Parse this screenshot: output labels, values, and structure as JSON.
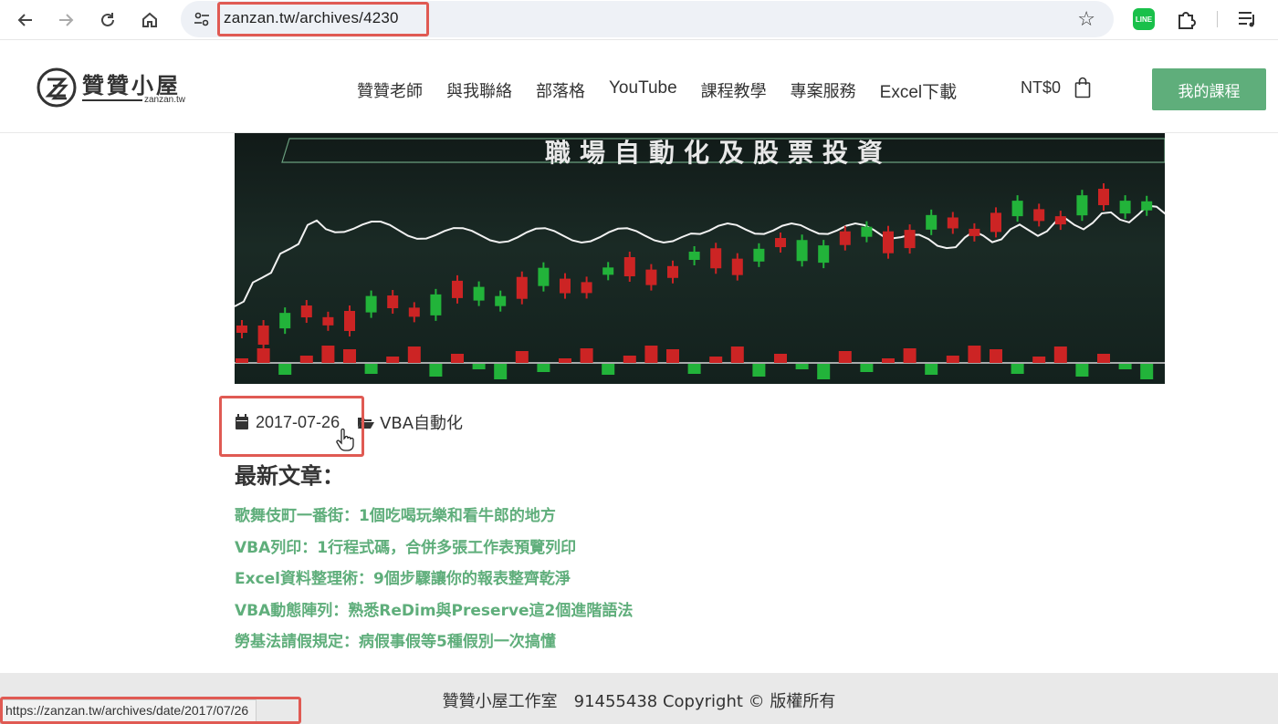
{
  "browser": {
    "url": "zanzan.tw/archives/4230",
    "icons": [
      "back-arrow-icon",
      "forward-arrow-icon",
      "reload-icon",
      "home-icon",
      "site-settings-icon",
      "bookmark-star-icon",
      "line-extension-icon",
      "extensions-puzzle-icon",
      "reading-list-icon"
    ],
    "line_ext_label": "LINE"
  },
  "header": {
    "logo_text": "贊贊小屋",
    "logo_sub": "zanzan.tw",
    "nav": [
      "贊贊老師",
      "與我聯絡",
      "部落格",
      "YouTube",
      "課程教學",
      "專案服務",
      "Excel下載"
    ],
    "cart_label": "NT$0",
    "course_button": "我的課程"
  },
  "hero": {
    "title": "職場自動化及股票投資"
  },
  "meta": {
    "date": "2017-07-26",
    "category": "VBA自動化"
  },
  "recent": {
    "title": "最新文章：",
    "items": [
      "歌舞伎町一番街：1個吃喝玩樂和看牛郎的地方",
      "VBA列印：1行程式碼，合併多張工作表預覽列印",
      "Excel資料整理術：9個步驟讓你的報表整齊乾淨",
      "VBA動態陣列：熟悉ReDim與Preserve這2個進階語法",
      "勞基法請假規定：病假事假等5種假別一次搞懂"
    ]
  },
  "footer": {
    "text": "贊贊小屋工作室　91455438 Copyright © 版權所有"
  },
  "status_bar": {
    "url": "https://zanzan.tw/archives/date/2017/07/26"
  },
  "colors": {
    "accent_green": "#5fae7b",
    "highlight_red": "#e05a53",
    "candle_up": "#22b33a",
    "candle_down": "#cc2424"
  }
}
